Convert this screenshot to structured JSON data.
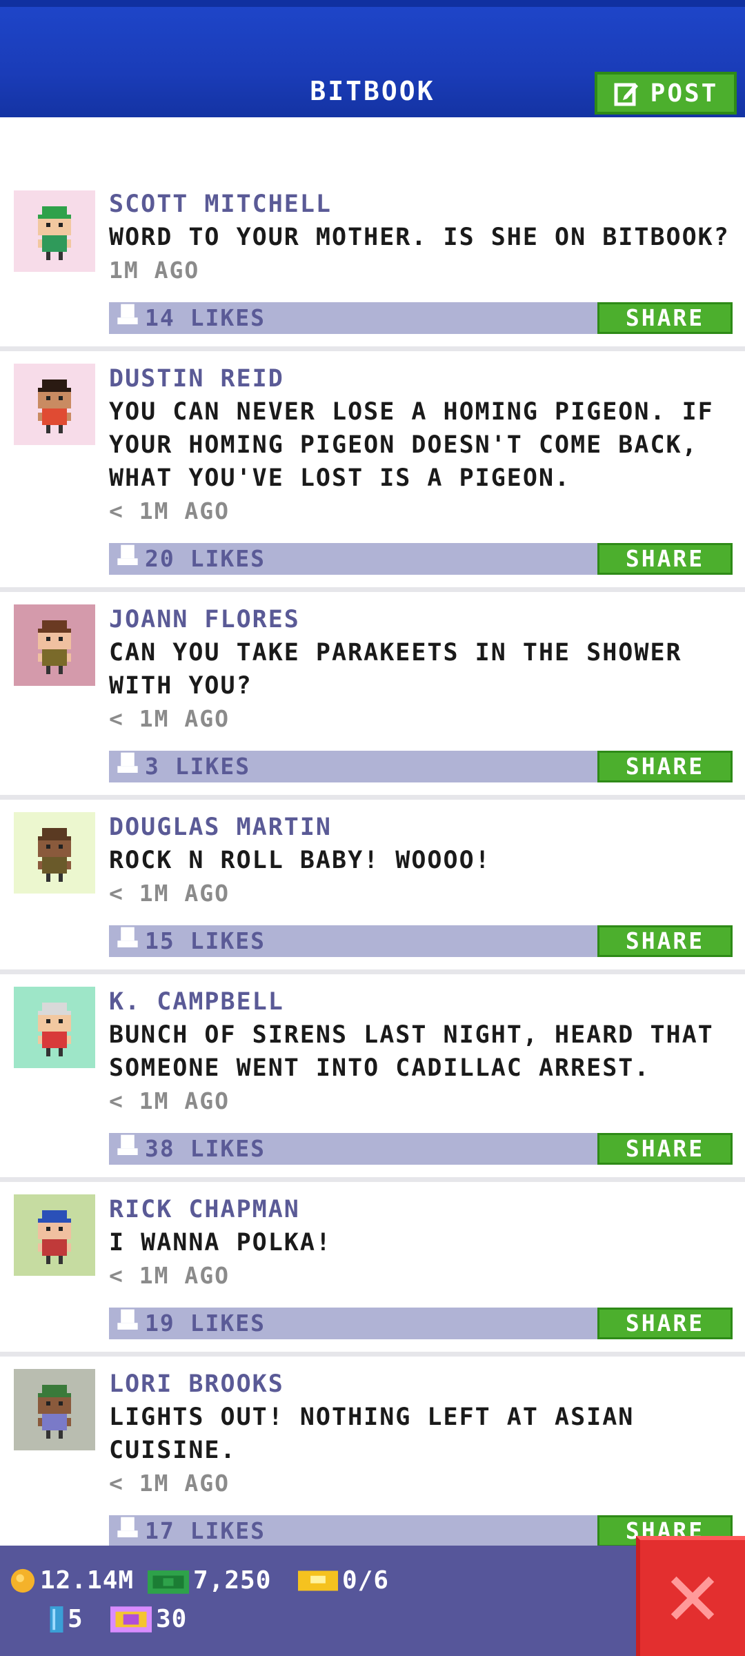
{
  "header": {
    "title": "BITBOOK",
    "post_label": "POST",
    "colors": {
      "bar": "#1a3cb8",
      "post_button": "#4caf2d"
    }
  },
  "feed": {
    "share_label": "SHARE",
    "posts": [
      {
        "name": "SCOTT MITCHELL",
        "message": "WORD TO YOUR MOTHER. IS SHE ON BITBOOK?",
        "time": "1M AGO",
        "likes": "14 LIKES",
        "avatar_bg": "#f7dce9",
        "avatar_icon": "green-cap-avatar-icon"
      },
      {
        "name": "DUSTIN REID",
        "message": "YOU CAN NEVER LOSE A HOMING PIGEON. IF YOUR HOMING PIGEON DOESN'T COME BACK, WHAT YOU'VE LOST IS A PIGEON.",
        "time": "< 1M AGO",
        "likes": "20 LIKES",
        "avatar_bg": "#f7dce9",
        "avatar_icon": "masked-avatar-icon"
      },
      {
        "name": "JOANN FLORES",
        "message": "CAN YOU TAKE PARAKEETS IN THE SHOWER WITH YOU?",
        "time": "< 1M AGO",
        "likes": "3 LIKES",
        "avatar_bg": "#d49aab",
        "avatar_icon": "brown-hair-avatar-icon"
      },
      {
        "name": "DOUGLAS MARTIN",
        "message": "ROCK N ROLL BABY! WOOOO!",
        "time": "< 1M AGO",
        "likes": "15 LIKES",
        "avatar_bg": "#ecf7cf",
        "avatar_icon": "bun-hair-avatar-icon"
      },
      {
        "name": "K. CAMPBELL",
        "message": "BUNCH OF SIRENS LAST NIGHT, HEARD THAT SOMEONE WENT INTO CADILLAC ARREST.",
        "time": "< 1M AGO",
        "likes": "38 LIKES",
        "avatar_bg": "#9ee6c8",
        "avatar_icon": "glasses-avatar-icon"
      },
      {
        "name": "RICK CHAPMAN",
        "message": "I WANNA POLKA!",
        "time": "< 1M AGO",
        "likes": "19 LIKES",
        "avatar_bg": "#c6dca1",
        "avatar_icon": "shield-hero-avatar-icon"
      },
      {
        "name": "LORI BROOKS",
        "message": "LIGHTS OUT! NOTHING LEFT AT ASIAN CUISINE.",
        "time": "< 1M AGO",
        "likes": "17 LIKES",
        "avatar_bg": "#b9bdb0",
        "avatar_icon": "headband-avatar-icon"
      }
    ]
  },
  "status": {
    "coins": "12.14M",
    "bux": "7,250",
    "tickets": "0/6",
    "gems": "5",
    "vip": "30"
  }
}
